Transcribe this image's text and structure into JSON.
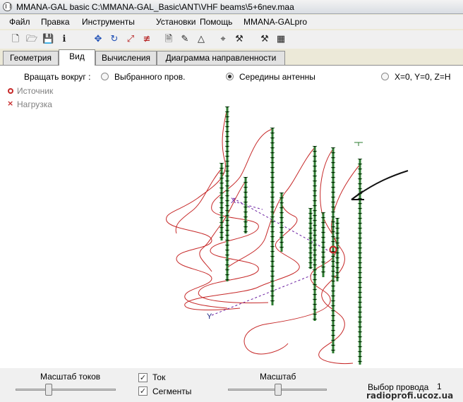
{
  "window": {
    "title": "MMANA-GAL basic C:\\MMANA-GAL_Basic\\ANT\\VHF beams\\5+6nev.maa"
  },
  "menu": [
    "Файл",
    "Правка",
    "Инструменты",
    "Установки",
    "Помощь",
    "MMANA-GALpro"
  ],
  "toolbar": [
    {
      "icon": "new-file-icon",
      "glyph": "🗋"
    },
    {
      "icon": "open-folder-icon",
      "glyph": "🗁"
    },
    {
      "icon": "save-disk-icon",
      "glyph": "💾"
    },
    {
      "icon": "info-icon",
      "glyph": "ℹ"
    },
    {
      "icon": "move-arrows-icon",
      "glyph": "✥"
    },
    {
      "icon": "rotate-icon",
      "glyph": "↻"
    },
    {
      "icon": "scale-icon",
      "glyph": "⤢"
    },
    {
      "icon": "wire-edit-icon",
      "glyph": "≢"
    },
    {
      "icon": "document-icon",
      "glyph": "🗎"
    },
    {
      "icon": "edit-pencil-icon",
      "glyph": "✎"
    },
    {
      "icon": "triangle-icon",
      "glyph": "△"
    },
    {
      "icon": "target-icon",
      "glyph": "⌖"
    },
    {
      "icon": "tools-icon",
      "glyph": "⚒"
    },
    {
      "icon": "calculator-icon",
      "glyph": "▦"
    }
  ],
  "tabs": [
    {
      "label": "Геометрия",
      "active": false
    },
    {
      "label": "Вид",
      "active": true
    },
    {
      "label": "Вычисления",
      "active": false
    },
    {
      "label": "Диаграмма направленности",
      "active": false
    }
  ],
  "rotate": {
    "label": "Вращать вокруг :",
    "options": [
      "Выбранного пров.",
      "Середины антенны",
      "X=0, Y=0, Z=H"
    ],
    "selected": "Середины антенны"
  },
  "legend": {
    "source": "Источник",
    "load": "Нагрузка"
  },
  "axes": {
    "x": "X",
    "y": "Y"
  },
  "colors": {
    "wire": "#2e7d32",
    "current": "#c62828",
    "axis": "#6a1fa0",
    "ground": "#1a237e"
  },
  "bottom": {
    "current_scale_label": "Масштаб токов",
    "current_scale_value": 0.3,
    "tok_label": "Ток",
    "tok_checked": true,
    "segments_label": "Сегменты",
    "segments_checked": true,
    "scale_label": "Масштаб",
    "scale_value": 0.48,
    "wire_select_label": "Выбор провода",
    "wire_select_value": "1"
  },
  "watermark": "radioprofi.ucoz.ua"
}
